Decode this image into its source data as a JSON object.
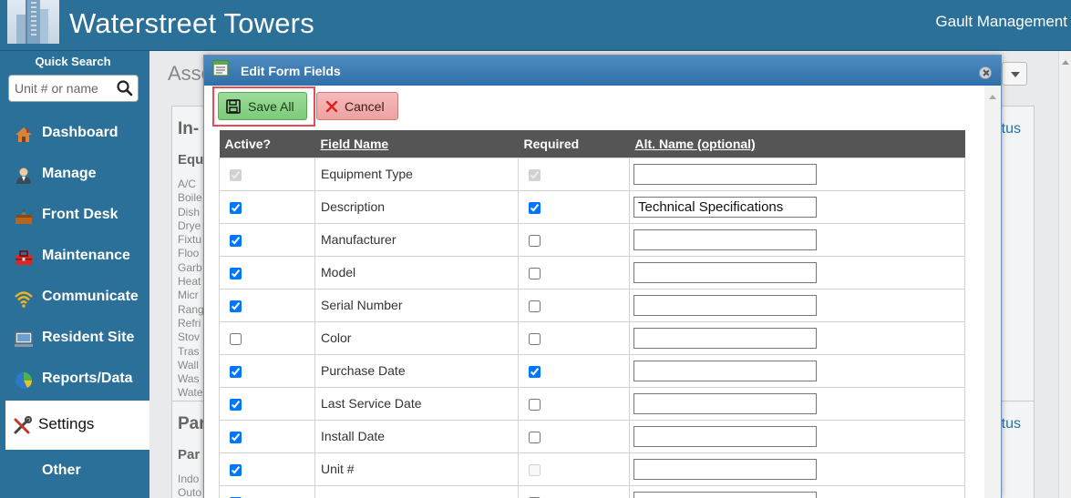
{
  "header": {
    "site_title": "Waterstreet Towers",
    "org_name": "Gault Management"
  },
  "sidebar": {
    "quick_search_label": "Quick Search",
    "quick_search_placeholder": "Unit # or name",
    "items": [
      {
        "label": "Dashboard",
        "icon": "house-icon"
      },
      {
        "label": "Manage",
        "icon": "person-icon"
      },
      {
        "label": "Front Desk",
        "icon": "desk-bell-icon"
      },
      {
        "label": "Maintenance",
        "icon": "toolbox-icon"
      },
      {
        "label": "Communicate",
        "icon": "wifi-icon"
      },
      {
        "label": "Resident Site",
        "icon": "monitor-icon"
      },
      {
        "label": "Reports/Data",
        "icon": "pie-chart-icon"
      },
      {
        "label": "Settings",
        "icon": "wrench-icon",
        "active": true
      },
      {
        "label": "Other",
        "icon": ""
      }
    ]
  },
  "background": {
    "title": "Asse",
    "panel1": {
      "heading": "In-",
      "status": "tus",
      "sub": "Equ",
      "items": [
        "A/C",
        "Boile",
        "Dish",
        "Drye",
        "Fixtu",
        "Floo",
        "Garb",
        "Heat",
        "Micr",
        "Rang",
        "Refri",
        "Stov",
        "Tras",
        "Wall",
        "Was",
        "Wate"
      ]
    },
    "panel2": {
      "heading": "Par",
      "status": "tus",
      "sub": "Par",
      "items": [
        "Indo",
        "Outo"
      ]
    }
  },
  "modal": {
    "title": "Edit Form Fields",
    "save_label": "Save All",
    "cancel_label": "Cancel",
    "columns": [
      "Active?",
      "Field Name",
      "Required",
      "Alt. Name (optional)"
    ],
    "rows": [
      {
        "field": "Equipment Type",
        "active": true,
        "active_disabled": true,
        "required": true,
        "required_disabled": true,
        "alt": ""
      },
      {
        "field": "Description",
        "active": true,
        "active_disabled": false,
        "required": true,
        "required_disabled": false,
        "alt": "Technical Specifications"
      },
      {
        "field": "Manufacturer",
        "active": true,
        "active_disabled": false,
        "required": false,
        "required_disabled": false,
        "alt": ""
      },
      {
        "field": "Model",
        "active": true,
        "active_disabled": false,
        "required": false,
        "required_disabled": false,
        "alt": ""
      },
      {
        "field": "Serial Number",
        "active": true,
        "active_disabled": false,
        "required": false,
        "required_disabled": false,
        "alt": ""
      },
      {
        "field": "Color",
        "active": false,
        "active_disabled": false,
        "required": false,
        "required_disabled": false,
        "alt": ""
      },
      {
        "field": "Purchase Date",
        "active": true,
        "active_disabled": false,
        "required": true,
        "required_disabled": false,
        "alt": ""
      },
      {
        "field": "Last Service Date",
        "active": true,
        "active_disabled": false,
        "required": false,
        "required_disabled": false,
        "alt": ""
      },
      {
        "field": "Install Date",
        "active": true,
        "active_disabled": false,
        "required": false,
        "required_disabled": false,
        "alt": ""
      },
      {
        "field": "Unit #",
        "active": true,
        "active_disabled": false,
        "required": false,
        "required_disabled": true,
        "alt": ""
      },
      {
        "field": "",
        "active": true,
        "active_disabled": false,
        "required": false,
        "required_disabled": false,
        "alt": ""
      }
    ]
  },
  "colors": {
    "header_bg": "#2a7098",
    "modal_title_bg": "#3a7cb5",
    "save_green": "#8fd48d",
    "cancel_red": "#f0abab",
    "highlight_red": "#e84a57"
  }
}
